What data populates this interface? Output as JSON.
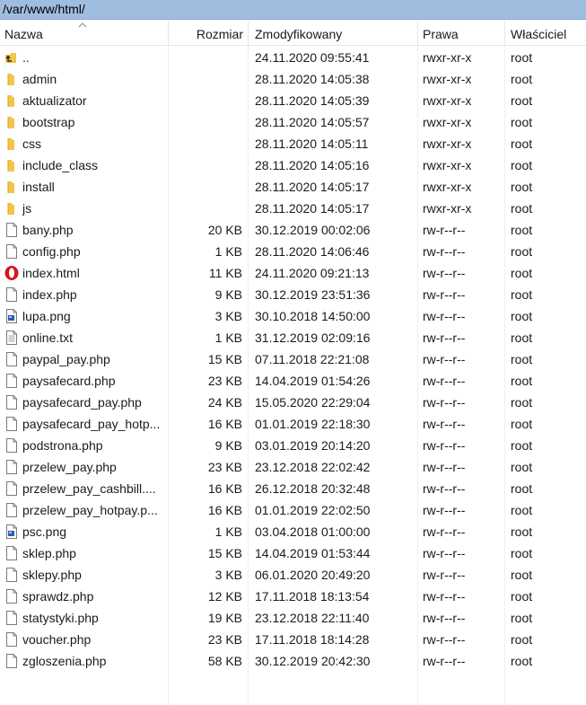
{
  "path": "/var/www/html/",
  "columns": {
    "name": "Nazwa",
    "size": "Rozmiar",
    "modified": "Zmodyfikowany",
    "permissions": "Prawa",
    "owner": "Właściciel"
  },
  "icon_names": {
    "parent": "parent-folder-icon",
    "folder": "folder-icon",
    "file": "file-icon",
    "opera": "opera-html-icon",
    "image": "image-file-icon",
    "text": "text-file-icon"
  },
  "colors": {
    "pathbar": "#9fbddf",
    "folder": "#f3c548",
    "opera": "#d5141e"
  },
  "rows": [
    {
      "name": "..",
      "size": "",
      "modified": "24.11.2020 09:55:41",
      "perm": "rwxr-xr-x",
      "owner": "root",
      "icon": "parent"
    },
    {
      "name": "admin",
      "size": "",
      "modified": "28.11.2020 14:05:38",
      "perm": "rwxr-xr-x",
      "owner": "root",
      "icon": "folder"
    },
    {
      "name": "aktualizator",
      "size": "",
      "modified": "28.11.2020 14:05:39",
      "perm": "rwxr-xr-x",
      "owner": "root",
      "icon": "folder"
    },
    {
      "name": "bootstrap",
      "size": "",
      "modified": "28.11.2020 14:05:57",
      "perm": "rwxr-xr-x",
      "owner": "root",
      "icon": "folder"
    },
    {
      "name": "css",
      "size": "",
      "modified": "28.11.2020 14:05:11",
      "perm": "rwxr-xr-x",
      "owner": "root",
      "icon": "folder"
    },
    {
      "name": "include_class",
      "size": "",
      "modified": "28.11.2020 14:05:16",
      "perm": "rwxr-xr-x",
      "owner": "root",
      "icon": "folder"
    },
    {
      "name": "install",
      "size": "",
      "modified": "28.11.2020 14:05:17",
      "perm": "rwxr-xr-x",
      "owner": "root",
      "icon": "folder"
    },
    {
      "name": "js",
      "size": "",
      "modified": "28.11.2020 14:05:17",
      "perm": "rwxr-xr-x",
      "owner": "root",
      "icon": "folder"
    },
    {
      "name": "bany.php",
      "size": "20 KB",
      "modified": "30.12.2019 00:02:06",
      "perm": "rw-r--r--",
      "owner": "root",
      "icon": "file"
    },
    {
      "name": "config.php",
      "size": "1 KB",
      "modified": "28.11.2020 14:06:46",
      "perm": "rw-r--r--",
      "owner": "root",
      "icon": "file"
    },
    {
      "name": "index.html",
      "size": "11 KB",
      "modified": "24.11.2020 09:21:13",
      "perm": "rw-r--r--",
      "owner": "root",
      "icon": "opera"
    },
    {
      "name": "index.php",
      "size": "9 KB",
      "modified": "30.12.2019 23:51:36",
      "perm": "rw-r--r--",
      "owner": "root",
      "icon": "file"
    },
    {
      "name": "lupa.png",
      "size": "3 KB",
      "modified": "30.10.2018 14:50:00",
      "perm": "rw-r--r--",
      "owner": "root",
      "icon": "image"
    },
    {
      "name": "online.txt",
      "size": "1 KB",
      "modified": "31.12.2019 02:09:16",
      "perm": "rw-r--r--",
      "owner": "root",
      "icon": "text"
    },
    {
      "name": "paypal_pay.php",
      "size": "15 KB",
      "modified": "07.11.2018 22:21:08",
      "perm": "rw-r--r--",
      "owner": "root",
      "icon": "file"
    },
    {
      "name": "paysafecard.php",
      "size": "23 KB",
      "modified": "14.04.2019 01:54:26",
      "perm": "rw-r--r--",
      "owner": "root",
      "icon": "file"
    },
    {
      "name": "paysafecard_pay.php",
      "size": "24 KB",
      "modified": "15.05.2020 22:29:04",
      "perm": "rw-r--r--",
      "owner": "root",
      "icon": "file"
    },
    {
      "name": "paysafecard_pay_hotp...",
      "size": "16 KB",
      "modified": "01.01.2019 22:18:30",
      "perm": "rw-r--r--",
      "owner": "root",
      "icon": "file"
    },
    {
      "name": "podstrona.php",
      "size": "9 KB",
      "modified": "03.01.2019 20:14:20",
      "perm": "rw-r--r--",
      "owner": "root",
      "icon": "file"
    },
    {
      "name": "przelew_pay.php",
      "size": "23 KB",
      "modified": "23.12.2018 22:02:42",
      "perm": "rw-r--r--",
      "owner": "root",
      "icon": "file"
    },
    {
      "name": "przelew_pay_cashbill....",
      "size": "16 KB",
      "modified": "26.12.2018 20:32:48",
      "perm": "rw-r--r--",
      "owner": "root",
      "icon": "file"
    },
    {
      "name": "przelew_pay_hotpay.p...",
      "size": "16 KB",
      "modified": "01.01.2019 22:02:50",
      "perm": "rw-r--r--",
      "owner": "root",
      "icon": "file"
    },
    {
      "name": "psc.png",
      "size": "1 KB",
      "modified": "03.04.2018 01:00:00",
      "perm": "rw-r--r--",
      "owner": "root",
      "icon": "image"
    },
    {
      "name": "sklep.php",
      "size": "15 KB",
      "modified": "14.04.2019 01:53:44",
      "perm": "rw-r--r--",
      "owner": "root",
      "icon": "file"
    },
    {
      "name": "sklepy.php",
      "size": "3 KB",
      "modified": "06.01.2020 20:49:20",
      "perm": "rw-r--r--",
      "owner": "root",
      "icon": "file"
    },
    {
      "name": "sprawdz.php",
      "size": "12 KB",
      "modified": "17.11.2018 18:13:54",
      "perm": "rw-r--r--",
      "owner": "root",
      "icon": "file"
    },
    {
      "name": "statystyki.php",
      "size": "19 KB",
      "modified": "23.12.2018 22:11:40",
      "perm": "rw-r--r--",
      "owner": "root",
      "icon": "file"
    },
    {
      "name": "voucher.php",
      "size": "23 KB",
      "modified": "17.11.2018 18:14:28",
      "perm": "rw-r--r--",
      "owner": "root",
      "icon": "file"
    },
    {
      "name": "zgloszenia.php",
      "size": "58 KB",
      "modified": "30.12.2019 20:42:30",
      "perm": "rw-r--r--",
      "owner": "root",
      "icon": "file"
    }
  ]
}
